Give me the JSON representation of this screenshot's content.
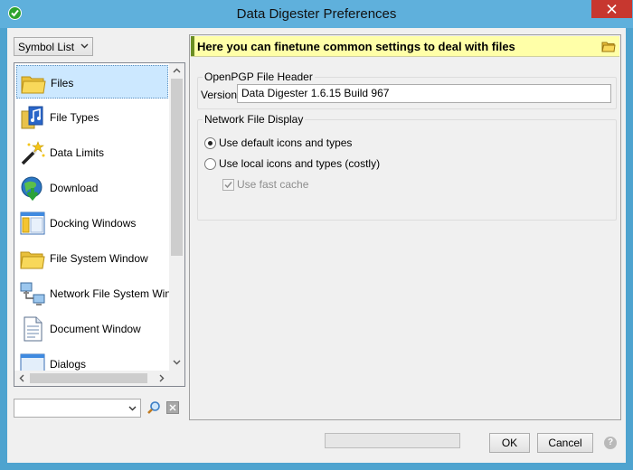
{
  "window": {
    "title": "Data Digester Preferences"
  },
  "left": {
    "view_select": "Symbol List",
    "items": [
      {
        "label": "Files",
        "icon": "folder-icon",
        "selected": true
      },
      {
        "label": "File Types",
        "icon": "music-file-icon"
      },
      {
        "label": "Data Limits",
        "icon": "magic-wand-icon"
      },
      {
        "label": "Download",
        "icon": "download-globe-icon"
      },
      {
        "label": "Docking Windows",
        "icon": "docking-window-icon"
      },
      {
        "label": "File System Window",
        "icon": "folder-icon"
      },
      {
        "label": "Network File System Windo",
        "icon": "network-computers-icon"
      },
      {
        "label": "Document Window",
        "icon": "document-icon"
      },
      {
        "label": "Dialogs",
        "icon": "dialog-window-icon"
      }
    ],
    "search_value": ""
  },
  "banner": {
    "text": "Here you can finetune common settings to deal with files",
    "icon": "folder-small-icon"
  },
  "openpgp": {
    "legend": "OpenPGP File Header",
    "version_label": "Version",
    "version_value": "Data Digester  1.6.15 Build 967"
  },
  "network": {
    "legend": "Network File Display",
    "opt_default": "Use default icons and types",
    "opt_local": "Use local icons and types (costly)",
    "fast_cache": "Use fast cache",
    "selected": "default",
    "fast_cache_checked": true,
    "fast_cache_enabled": false
  },
  "footer": {
    "progress_fraction": 0.0,
    "ok": "OK",
    "cancel": "Cancel",
    "help_icon": "help-icon"
  },
  "colors": {
    "titlebar": "#5fb0dc",
    "banner": "#ffffa8",
    "selection": "#cce8ff",
    "close": "#c7372f"
  }
}
